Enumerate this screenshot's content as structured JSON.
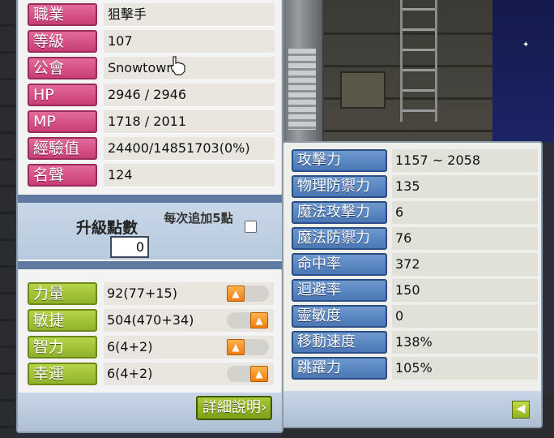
{
  "info": [
    {
      "label": "職業",
      "value": "狙擊手"
    },
    {
      "label": "等級",
      "value": "107"
    },
    {
      "label": "公會",
      "value": "Snowtown"
    },
    {
      "label": "HP",
      "value": "2946 / 2946"
    },
    {
      "label": "MP",
      "value": "1718 / 2011"
    },
    {
      "label": "經驗值",
      "value": "24400/14851703(0%)"
    },
    {
      "label": "名聲",
      "value": "124"
    }
  ],
  "ap": {
    "label": "升級點數",
    "value": "0",
    "auto_note": "每次追加5點"
  },
  "stats": [
    {
      "label": "力量",
      "value": "92(77+15)",
      "up_icon": "up-arrow-icon"
    },
    {
      "label": "敏捷",
      "value": "504(470+34)",
      "up_icon": "up-arrow-icon"
    },
    {
      "label": "智力",
      "value": "6(4+2)",
      "up_icon": "up-arrow-icon"
    },
    {
      "label": "幸運",
      "value": "6(4+2)",
      "up_icon": "up-arrow-icon"
    }
  ],
  "detail_button": "詳細說明›",
  "detail": [
    {
      "label": "攻擊力",
      "value": "1157 ~ 2058"
    },
    {
      "label": "物理防禦力",
      "value": "135"
    },
    {
      "label": "魔法攻擊力",
      "value": "6"
    },
    {
      "label": "魔法防禦力",
      "value": "76"
    },
    {
      "label": "命中率",
      "value": "372"
    },
    {
      "label": "迴避率",
      "value": "150"
    },
    {
      "label": "靈敏度",
      "value": "0"
    },
    {
      "label": "移動速度",
      "value": "138%"
    },
    {
      "label": "跳躍力",
      "value": "105%"
    }
  ],
  "colors": {
    "pink_label": "#d04c84",
    "green_label": "#9cbf33",
    "blue_label": "#5a86c2",
    "up_button": "#f08a1c"
  }
}
